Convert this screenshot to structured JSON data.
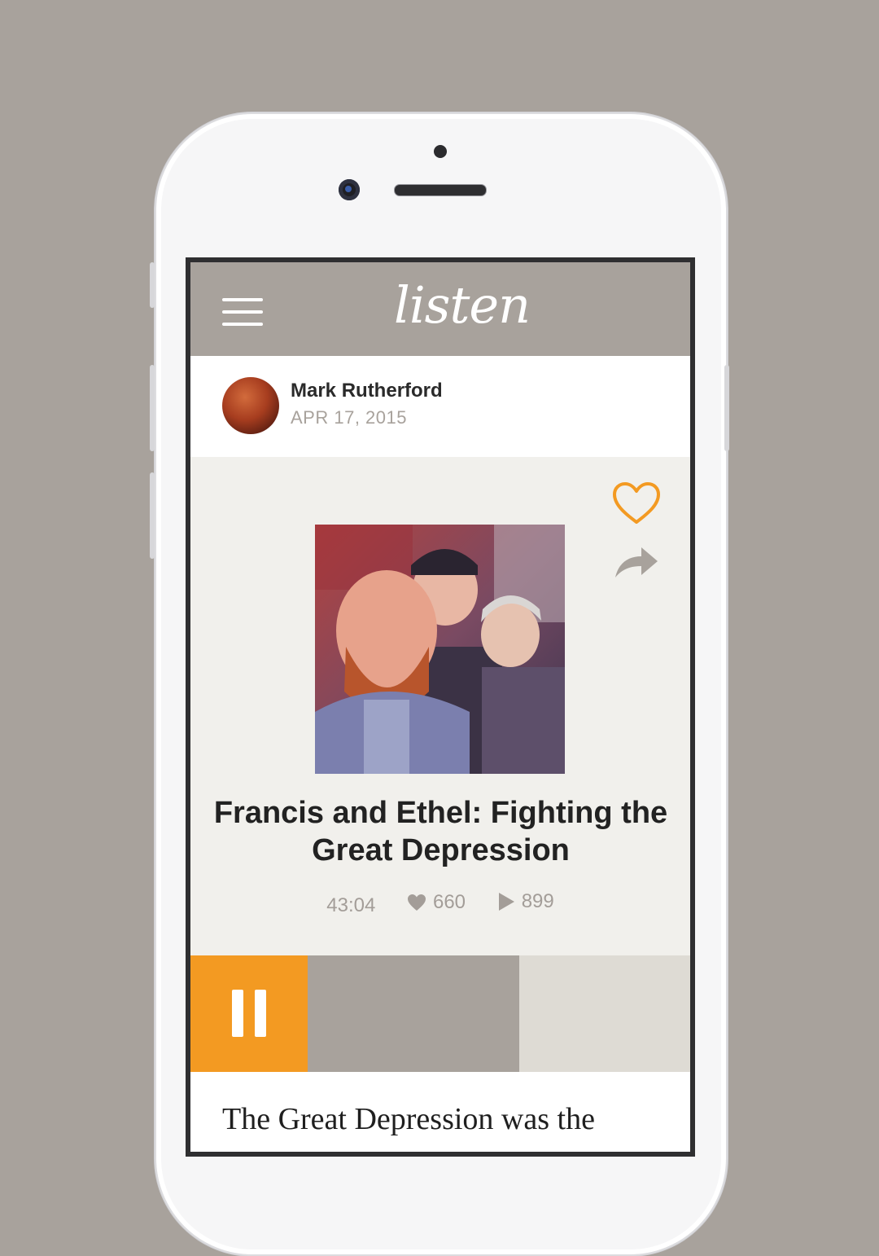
{
  "app": {
    "logo": "listen"
  },
  "author": {
    "name": "Mark Rutherford",
    "date": "APR 17, 2015"
  },
  "story": {
    "title": "Francis and Ethel: Fighting the Great Depression",
    "duration": "43:04",
    "likes": "660",
    "plays": "899"
  },
  "player": {
    "state": "playing",
    "progress": 0.45
  },
  "body": {
    "text": "The Great Depression was the"
  },
  "colors": {
    "accent": "#f39a22",
    "header": "#a8a29c",
    "muted": "#a39d98"
  },
  "icons": [
    "menu-icon",
    "heart-icon",
    "share-icon",
    "like-heart-icon",
    "play-icon",
    "pause-icon"
  ]
}
